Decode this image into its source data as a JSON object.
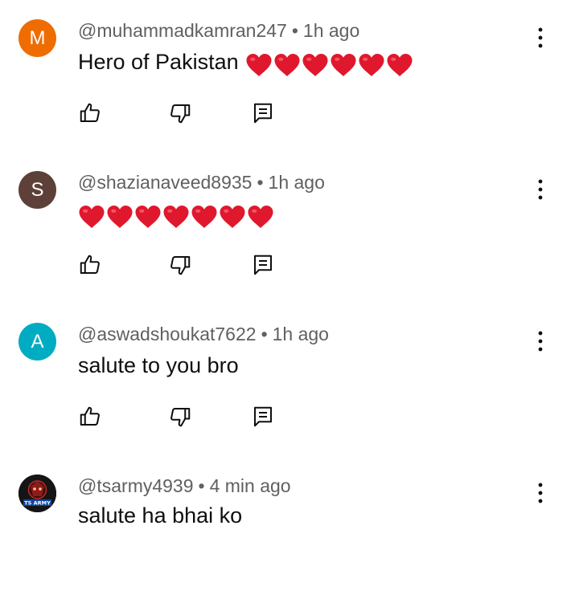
{
  "comments": [
    {
      "avatar_letter": "M",
      "avatar_color": "#ef6c00",
      "handle": "@muhammadkamran247",
      "separator": "•",
      "time": "1h ago",
      "text": "Hero of Pakistan",
      "hearts": 6
    },
    {
      "avatar_letter": "S",
      "avatar_color": "#5d4037",
      "handle": "@shazianaveed8935",
      "separator": "•",
      "time": "1h ago",
      "text": "",
      "hearts": 7
    },
    {
      "avatar_letter": "A",
      "avatar_color": "#00acc1",
      "handle": "@aswadshoukat7622",
      "separator": "•",
      "time": "1h ago",
      "text": "salute to you bro",
      "hearts": 0
    },
    {
      "avatar_letter": "",
      "avatar_color": "#1a1a1a",
      "avatar_badge_text": "TS ARMY",
      "handle": "@tsarmy4939",
      "separator": "•",
      "time": "4 min ago",
      "text": "salute ha bhai ko",
      "hearts": 0
    }
  ],
  "icons": {
    "like": "thumb-up-icon",
    "dislike": "thumb-down-icon",
    "reply": "reply-comment-icon",
    "more": "more-vertical-icon",
    "heart": "red-heart-emoji"
  },
  "colors": {
    "heart": "#e0182d",
    "meta_text": "#606060",
    "body_text": "#0f0f0f"
  }
}
